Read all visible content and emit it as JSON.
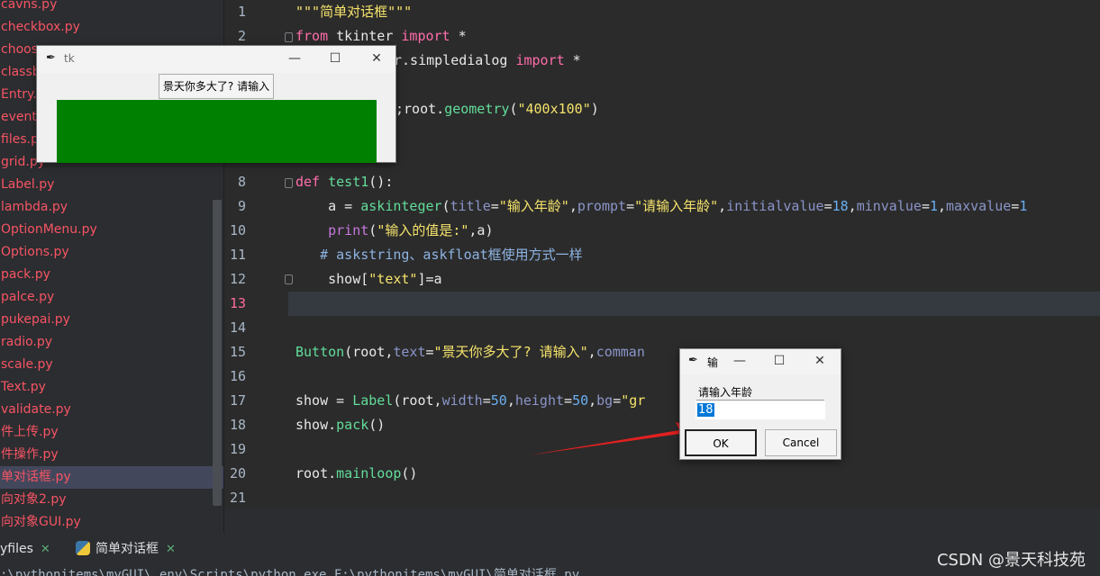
{
  "sidebar": {
    "files": [
      "cavns.py",
      "checkbox.py",
      "choos",
      "classb",
      "Entry.",
      "event.",
      "files.p",
      "grid.py",
      "Label.py",
      "lambda.py",
      "OptionMenu.py",
      "Options.py",
      "pack.py",
      "palce.py",
      "pukepai.py",
      "radio.py",
      "scale.py",
      "Text.py",
      "validate.py",
      "件上传.py",
      "件操作.py",
      "单对话框.py",
      "向对象2.py",
      "向对象GUI.py"
    ],
    "selected_index": 21
  },
  "editor": {
    "line_numbers": [
      "1",
      "2",
      "3",
      "4",
      "5",
      "6",
      "7",
      "8",
      "9",
      "10",
      "11",
      "12",
      "13",
      "14",
      "15",
      "16",
      "17",
      "18",
      "19",
      "20",
      "21"
    ],
    "current_line": "13",
    "lines": {
      "l1": "\"\"\"简单对话框\"\"\"",
      "l2_kw1": "from",
      "l2_mod": " tkinter ",
      "l2_kw2": "import",
      "l2_star": " *",
      "l3_mod": "r.simpledialog ",
      "l3_kw": "import",
      "l3_star": " *",
      "l5_a": ";root.",
      "l5_fn": "geometry",
      "l5_b": "(",
      "l5_str": "\"400x100\"",
      "l5_c": ")",
      "l8_kw": "def",
      "l8_fn": " test1",
      "l8_rest": "():",
      "l9_a": "    a = ",
      "l9_fn": "askinteger",
      "l9_p1": "(",
      "l9_k1": "title",
      "l9_e1": "=",
      "l9_s1": "\"输入年龄\"",
      "l9_c1": ",",
      "l9_k2": "prompt",
      "l9_e2": "=",
      "l9_s2": "\"请输入年龄\"",
      "l9_c2": ",",
      "l9_k3": "initialvalue",
      "l9_e3": "=",
      "l9_n3": "18",
      "l9_c3": ",",
      "l9_k4": "minvalue",
      "l9_e4": "=",
      "l9_n4": "1",
      "l9_c4": ",",
      "l9_k5": "maxvalue",
      "l9_e5": "=",
      "l9_n5": "1",
      "l10_ind": "    ",
      "l10_fn": "print",
      "l10_p": "(",
      "l10_s": "\"输入的值是:\"",
      "l10_r": ",a)",
      "l11": "   # askstring、askfloat框使用方式一样",
      "l12_a": "    show[",
      "l12_s": "\"text\"",
      "l12_b": "]=a",
      "l15_fn": "Button",
      "l15_a": "(root,",
      "l15_k": "text",
      "l15_e": "=",
      "l15_s": "\"景天你多大了? 请输入\"",
      "l15_c": ",",
      "l15_k2": "comman",
      "l17_a": "show = ",
      "l17_fn": "Label",
      "l17_b": "(root,",
      "l17_k1": "width",
      "l17_e1": "=",
      "l17_n1": "50",
      "l17_c1": ",",
      "l17_k2": "height",
      "l17_e2": "=",
      "l17_n2": "50",
      "l17_c2": ",",
      "l17_k3": "bg",
      "l17_e3": "=",
      "l17_s3": "\"gr",
      "l18_a": "show.",
      "l18_fn": "pack",
      "l18_b": "()",
      "l20_a": "root.",
      "l20_fn": "mainloop",
      "l20_b": "()"
    }
  },
  "bottom": {
    "tab1_label": "yfiles",
    "tab2_label": "简单对话框",
    "tab_close": "✕",
    "run_line": ":\\pythonitems\\myGUI\\.env\\Scripts\\python.exe F:\\pythonitems\\myGUI\\简单对话框.py",
    "watermark": "CSDN @景天科技苑"
  },
  "tk_window": {
    "title": "tk",
    "button_label": "景天你多大了? 请输入",
    "label_bg": "#008000"
  },
  "dialog": {
    "title": "输",
    "prompt": "请输入年龄",
    "input_value": "18",
    "ok_label": "OK",
    "cancel_label": "Cancel"
  },
  "window_controls": {
    "minimize": "—",
    "maximize": "☐",
    "close": "✕"
  },
  "colors": {
    "arrow": "#e02020",
    "error_file": "#f75464"
  }
}
